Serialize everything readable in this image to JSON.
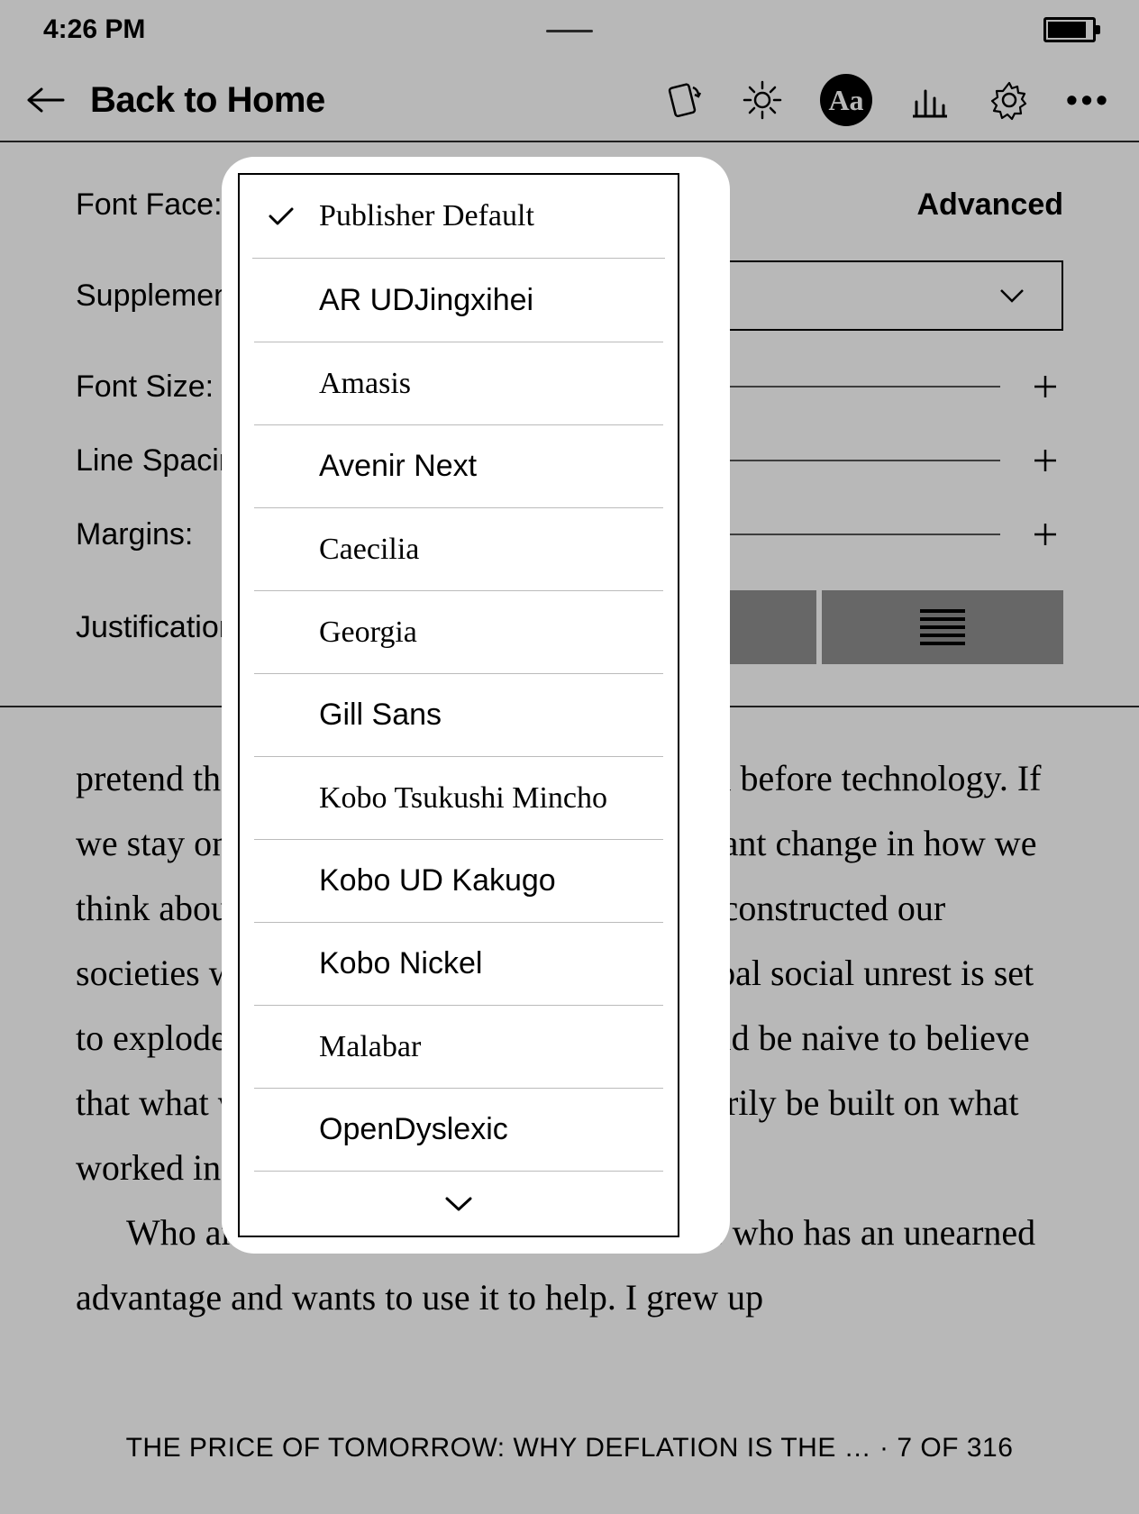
{
  "statusbar": {
    "time": "4:26 PM"
  },
  "navbar": {
    "back_label": "Back to Home"
  },
  "settings": {
    "font_face_label": "Font Face:",
    "advanced_label": "Advanced",
    "supplemental_label": "Supplemental Font:",
    "font_size_label": "Font Size:",
    "line_spacing_label": "Line Spacing:",
    "margins_label": "Margins:",
    "justification_label": "Justification:"
  },
  "font_menu": {
    "selected": "Publisher Default",
    "items": [
      "Publisher Default",
      "AR UDJingxihei",
      "Amasis",
      "Avenir Next",
      "Caecilia",
      "Georgia",
      "Gill Sans",
      "Kobo Tsukushi Mincho",
      "Kobo UD Kakugo",
      "Kobo Nickel",
      "Malabar",
      "OpenDyslexic"
    ]
  },
  "body": {
    "p1": "pretend the economy works as it did in an era before technology. If we stay on the existing path, without significant change in how we think about economics and the way we have constructed our societies will ensure chaos. On this path, global social unrest is set to explode. In this extraordinary time, it would be naive to believe that what will work in the future will necessarily be built on what worked in the past.",
    "p2": "Who am I to be saying this? I'm someone who has an unearned advantage and wants to use it to help. I grew up"
  },
  "footer": {
    "text": "THE PRICE OF TOMORROW: WHY DEFLATION IS THE … · 7 OF 316"
  }
}
